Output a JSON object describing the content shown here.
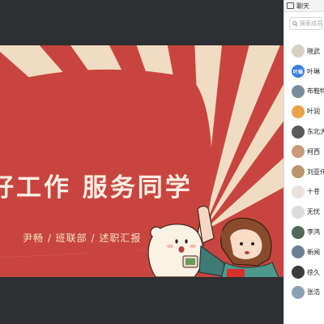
{
  "slide": {
    "title": "好工作 服务同学",
    "subtitle": "尹畅 / 班联部 / 述职汇报",
    "colors": {
      "background": "#c8453f",
      "ray": "#f0dcc2",
      "title": "#fbeee2"
    }
  },
  "panel": {
    "title": "聊天",
    "search_placeholder": "搜索成员"
  },
  "members": [
    {
      "name": "晓武",
      "avatar_text": "",
      "avatar_color": "#d9d0c4"
    },
    {
      "name": "叶琳",
      "avatar_text": "叶琳",
      "avatar_color": "#3a7fe0"
    },
    {
      "name": "布鞋特",
      "avatar_text": "",
      "avatar_color": "#7a8d9c"
    },
    {
      "name": "叶润",
      "avatar_text": "",
      "avatar_color": "#e8a24a"
    },
    {
      "name": "东北大",
      "avatar_text": "",
      "avatar_color": "#5a5a5a"
    },
    {
      "name": "柯西",
      "avatar_text": "",
      "avatar_color": "#c79a7a"
    },
    {
      "name": "刘亚伟",
      "avatar_text": "",
      "avatar_color": "#b8956a"
    },
    {
      "name": "十苍",
      "avatar_text": "",
      "avatar_color": "#e9e2d8"
    },
    {
      "name": "无忧",
      "avatar_text": "",
      "avatar_color": "#dcdcdc"
    },
    {
      "name": "李鸿",
      "avatar_text": "",
      "avatar_color": "#4f6a58"
    },
    {
      "name": "新闻",
      "avatar_text": "",
      "avatar_color": "#6b7f95"
    },
    {
      "name": "徐久",
      "avatar_text": "",
      "avatar_color": "#3c3c3c"
    },
    {
      "name": "张浩",
      "avatar_text": "",
      "avatar_color": "#8aa0b5"
    }
  ]
}
